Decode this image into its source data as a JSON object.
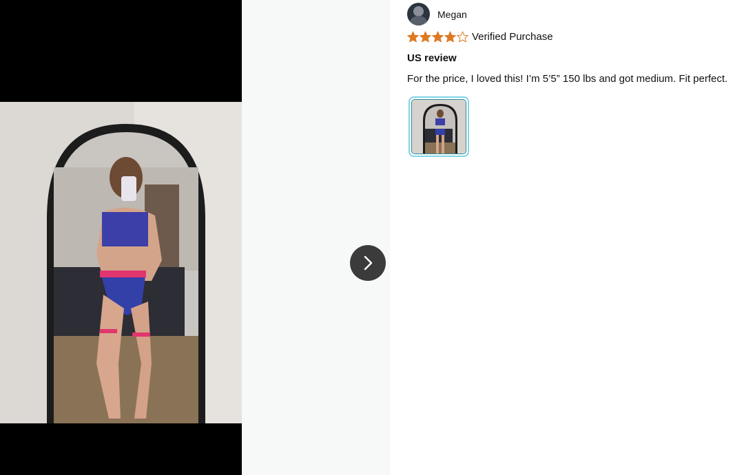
{
  "viewer": {
    "next_icon": "chevron-right-icon"
  },
  "review": {
    "reviewer_name": "Megan",
    "rating": 4,
    "rating_max": 5,
    "star_color": "#de7921",
    "verified_label": "Verified Purchase",
    "title": "US review",
    "body": "For the price, I loved this! I’m 5’5” 150 lbs and got medium. Fit perfect."
  }
}
